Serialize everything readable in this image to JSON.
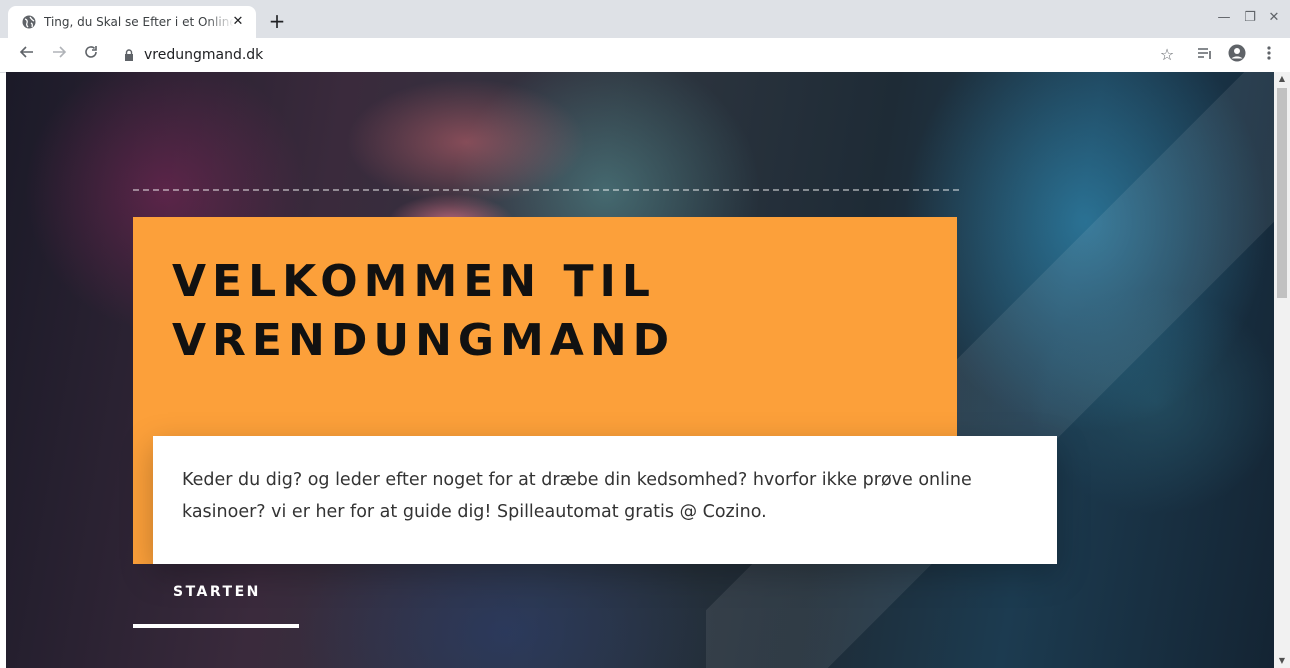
{
  "browser": {
    "tab_title": "Ting, du Skal se Efter i et Online Casino",
    "tab_close": "✕",
    "new_tab": "+",
    "url": "vredungmand.dk",
    "window_controls": {
      "minimize": "—",
      "restore": "❐",
      "close": "✕"
    }
  },
  "hero": {
    "headline_line1": "VELKOMMEN TIL",
    "headline_line2": "VRENDUNGMAND",
    "description": "Keder du dig? og leder efter noget for at dræbe din kedsomhed? hvorfor ikke prøve online kasinoer? vi er her for at guide dig! Spilleautomat gratis @ Cozino.",
    "cta_label": "STARTEN",
    "accent_color": "#fca03a"
  },
  "icons": {
    "back": "back-arrow-icon",
    "forward": "forward-arrow-icon",
    "reload": "reload-icon",
    "lock": "lock-icon",
    "star": "bookmark-star-icon",
    "reading_list": "reading-list-icon",
    "profile": "profile-icon",
    "menu": "kebab-menu-icon",
    "favicon": "globe-favicon-icon"
  }
}
